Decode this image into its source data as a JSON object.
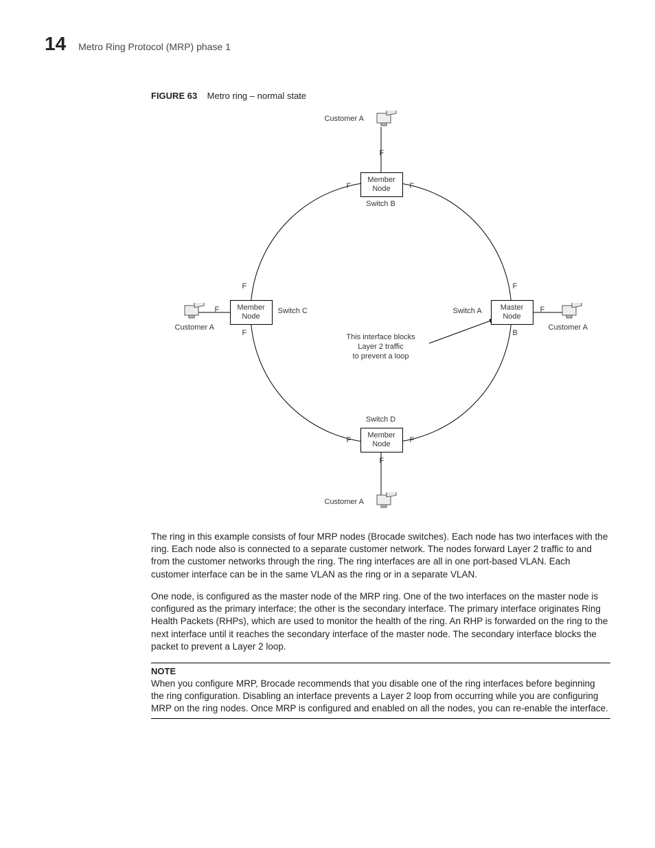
{
  "header": {
    "chapter": "14",
    "title": "Metro Ring Protocol (MRP) phase 1"
  },
  "figure": {
    "label": "FIGURE 63",
    "caption": "Metro ring – normal state"
  },
  "diagram": {
    "customer": "Customer A",
    "member": "Member\nNode",
    "master": "Master\nNode",
    "switches": {
      "top": "Switch B",
      "left": "Switch C",
      "right": "Switch A",
      "bottom": "Switch D"
    },
    "ports": {
      "F": "F",
      "B": "B"
    },
    "annotation": "This interface blocks\nLayer 2 traffic\nto prevent a loop"
  },
  "body": {
    "p1": "The ring in this example consists of four MRP nodes (Brocade switches). Each node has two interfaces with the ring. Each node also is connected to a separate customer network. The nodes forward Layer 2 traffic to and from the customer networks through the ring. The ring interfaces are all in one port-based VLAN. Each customer interface can be in the same VLAN as the ring or in a separate VLAN.",
    "p2": "One node, is configured as the master node of the MRP ring. One of the two interfaces on the master node is configured as the primary interface; the other is the secondary interface. The primary interface originates Ring Health Packets (RHPs), which are used to monitor the health of the ring. An RHP is forwarded on the ring to the next interface until it reaches the secondary interface of the master node. The secondary interface blocks the packet to prevent a Layer 2 loop."
  },
  "note": {
    "heading": "NOTE",
    "text": "When you configure MRP, Brocade recommends that you disable one of the ring interfaces before beginning the ring configuration. Disabling an interface prevents a Layer 2 loop from occurring while you are configuring MRP on the ring nodes. Once MRP is configured and enabled on all the nodes, you can re-enable the interface."
  }
}
